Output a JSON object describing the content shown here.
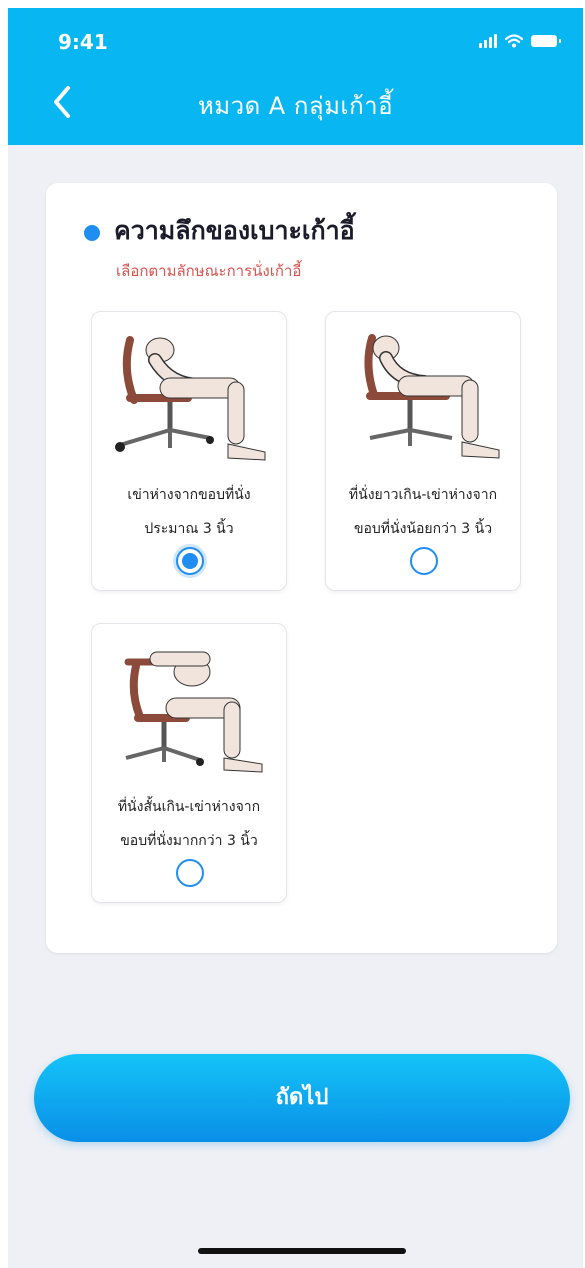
{
  "status_bar": {
    "time": "9:41"
  },
  "header": {
    "title": "หมวด A กลุ่มเก้าอี้"
  },
  "question": {
    "title": "ความลึกของเบาะเก้าอี้",
    "subtitle": "เลือกตามลักษณะการนั่งเก้าอี้"
  },
  "options": [
    {
      "line1": "เข่าห่างจากขอบที่นั่ง",
      "line2": "ประมาณ 3 นิ้ว",
      "selected": true,
      "illustration": "chair-posture-normal"
    },
    {
      "line1": "ที่นั่งยาวเกิน-เข่าห่างจาก",
      "line2": "ขอบที่นั่งน้อยกว่า 3 นิ้ว",
      "selected": false,
      "illustration": "chair-posture-seat-too-long"
    },
    {
      "line1": "ที่นั่งสั้นเกิน-เข่าห่างจาก",
      "line2": "ขอบที่นั่งมากกว่า 3 นิ้ว",
      "selected": false,
      "illustration": "chair-posture-seat-too-short"
    }
  ],
  "footer": {
    "next_label": "ถัดไป"
  },
  "colors": {
    "header": "#08b6f1",
    "accent": "#1f8ef0",
    "subtitle": "#d9534f",
    "background": "#eef0f5"
  }
}
